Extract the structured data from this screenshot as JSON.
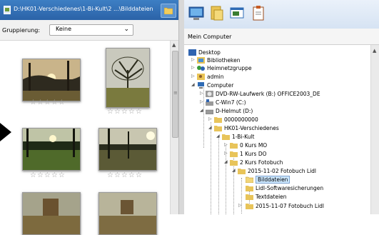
{
  "left_pane": {
    "path": "D:\\HK01-Verschiedenes\\1-Bi-Kult\\2 ...\\Bilddateien",
    "grouping_label": "Gruppierung:",
    "grouping_value": "Keine",
    "rating_stars": "☆☆☆☆☆"
  },
  "right_pane": {
    "header_title": "Mein Computer",
    "tree": {
      "desktop": "Desktop",
      "bibliotheken": "Bibliotheken",
      "heimnetzgruppe": "Heimnetzgruppe",
      "admin": "admin",
      "computer": "Computer",
      "dvd": "DVD-RW-Laufwerk (B:) OFFICE2003_DE",
      "c_drive": "C-Win7 (C:)",
      "d_drive": "D-Helmut (D:)",
      "f0": "0000000000",
      "hk01": "HK01-Verschiedenes",
      "bikult": "1-Bi-Kult",
      "kursmo": "0 Kurs MO",
      "kursdo": "1 Kurs DO",
      "kursfoto": "2 Kurs Fotobuch",
      "fb1102": "2015-11-02 Fotobuch Lidl",
      "bilddateien": "Bilddateien",
      "lidlsoft": "Lidl-Softwaresicherungen",
      "textdateien": "Textdateien",
      "fb1107": "2015-11-07 Fotobuch Lidl"
    }
  },
  "colors": {
    "path_bar": "#2b63a8",
    "selection": "#cde8ff",
    "folder": "#e8c45a"
  }
}
